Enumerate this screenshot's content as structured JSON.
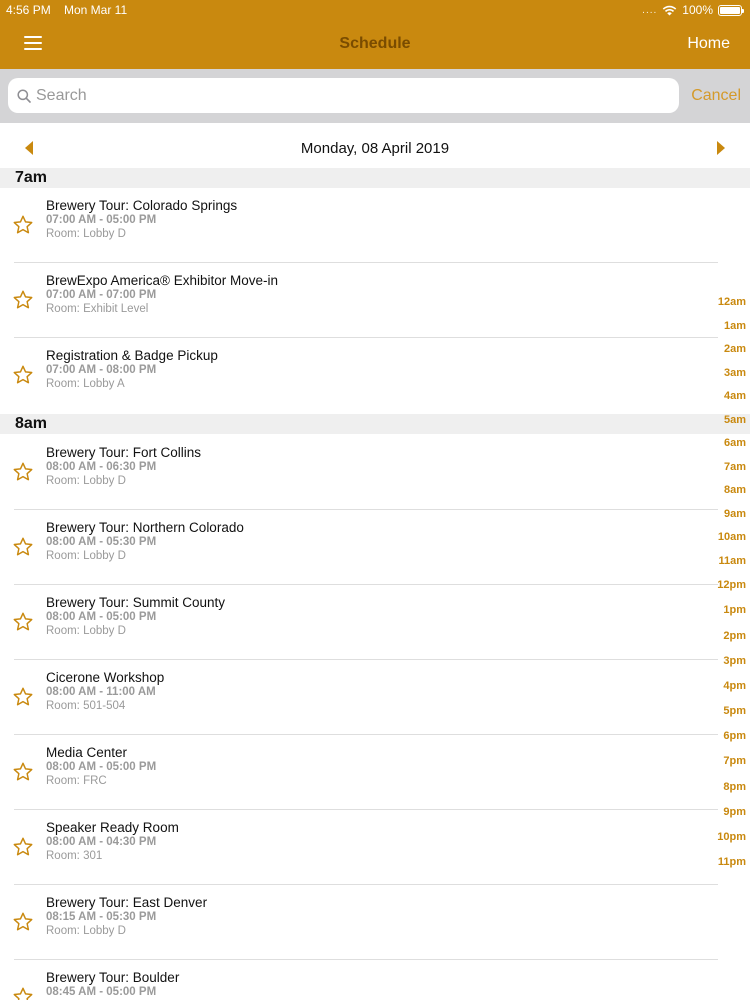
{
  "status_bar": {
    "time": "4:56 PM",
    "date": "Mon Mar 11",
    "signal": "....",
    "battery": "100%"
  },
  "nav": {
    "title": "Schedule",
    "home_label": "Home"
  },
  "search": {
    "placeholder": "Search",
    "cancel_label": "Cancel"
  },
  "date_nav": {
    "label": "Monday, 08 April 2019"
  },
  "sections": [
    {
      "label": "7am",
      "events": [
        {
          "title": "Brewery Tour: Colorado Springs",
          "time": "07:00 AM - 05:00 PM",
          "room": "Room: Lobby D"
        },
        {
          "title": "BrewExpo America® Exhibitor Move-in",
          "time": "07:00 AM - 07:00 PM",
          "room": "Room: Exhibit Level"
        },
        {
          "title": "Registration & Badge Pickup",
          "time": "07:00 AM - 08:00 PM",
          "room": "Room: Lobby A"
        }
      ]
    },
    {
      "label": "8am",
      "events": [
        {
          "title": "Brewery Tour: Fort Collins",
          "time": "08:00 AM - 06:30 PM",
          "room": "Room: Lobby D"
        },
        {
          "title": "Brewery Tour: Northern Colorado",
          "time": "08:00 AM - 05:30 PM",
          "room": "Room: Lobby D"
        },
        {
          "title": "Brewery Tour: Summit County",
          "time": "08:00 AM - 05:00 PM",
          "room": "Room: Lobby D"
        },
        {
          "title": "Cicerone Workshop",
          "time": "08:00 AM - 11:00 AM",
          "room": "Room: 501-504"
        },
        {
          "title": "Media Center",
          "time": "08:00 AM - 05:00 PM",
          "room": "Room: FRC"
        },
        {
          "title": "Speaker Ready Room",
          "time": "08:00 AM - 04:30 PM",
          "room": "Room: 301"
        },
        {
          "title": "Brewery Tour: East Denver",
          "time": "08:15 AM - 05:30 PM",
          "room": "Room: Lobby D"
        },
        {
          "title": "Brewery Tour: Boulder",
          "time": "08:45 AM - 05:00 PM",
          "room": ""
        }
      ]
    }
  ],
  "hour_index": [
    "12am",
    "1am",
    "2am",
    "3am",
    "4am",
    "5am",
    "6am",
    "7am",
    "8am",
    "9am",
    "10am",
    "11am",
    "12pm",
    "1pm",
    "2pm",
    "3pm",
    "4pm",
    "5pm",
    "6pm",
    "7pm",
    "8pm",
    "9pm",
    "10pm",
    "11pm"
  ],
  "colors": {
    "accent": "#c9890f",
    "title": "#7a4c00",
    "cancel": "#d49a2a",
    "star": "#c9890f"
  }
}
